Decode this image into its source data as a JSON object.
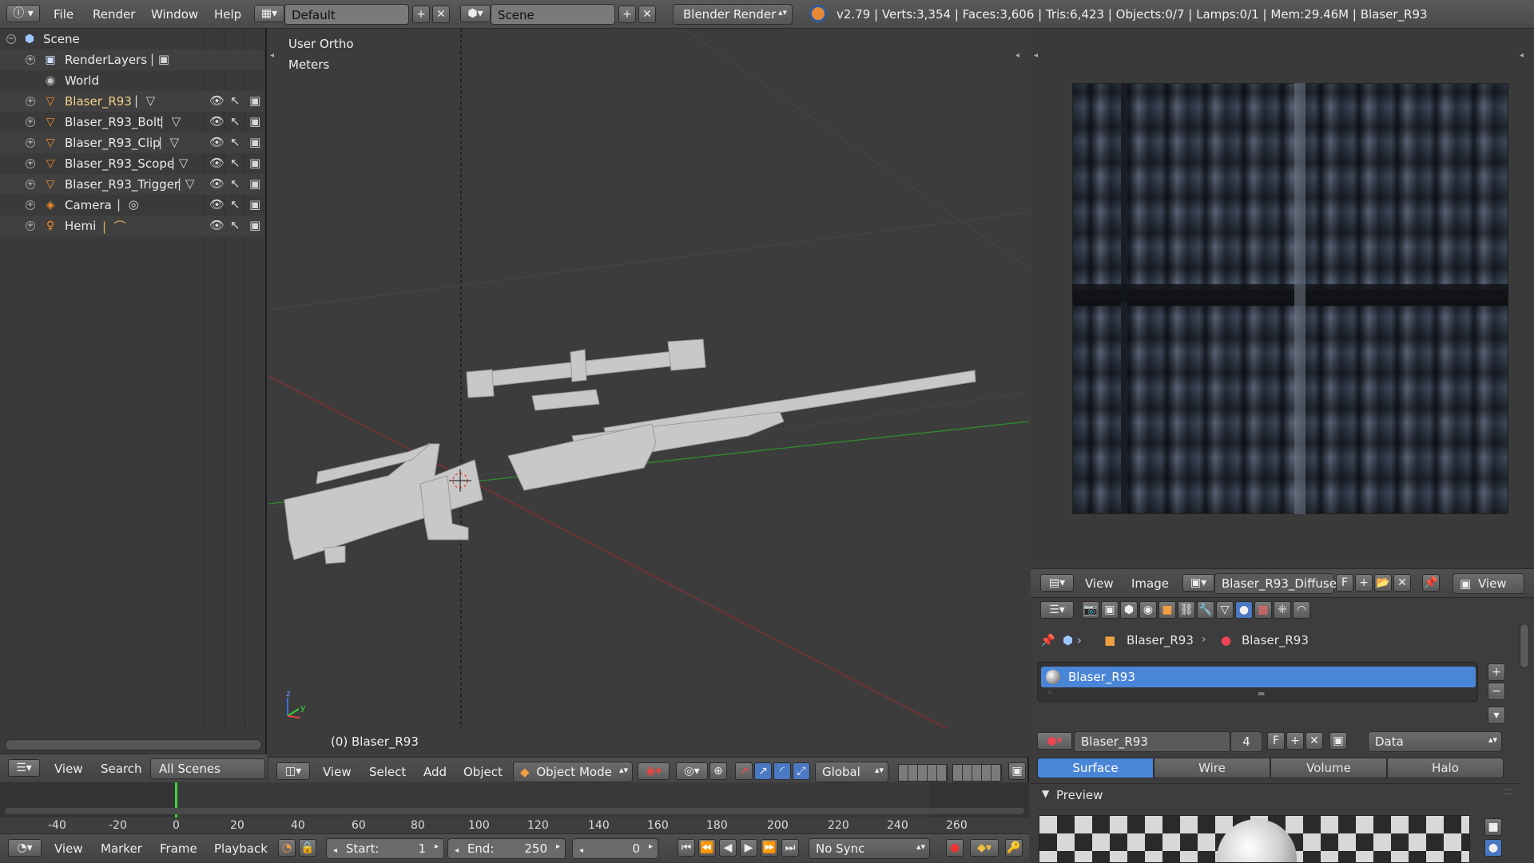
{
  "topbar": {
    "menus": [
      "File",
      "Render",
      "Window",
      "Help"
    ],
    "layout": "Default",
    "scene": "Scene",
    "engine": "Blender Render",
    "stats": "v2.79 | Verts:3,354 | Faces:3,606 | Tris:6,423 | Objects:0/7 | Lamps:0/1 | Mem:29.46M | Blaser_R93"
  },
  "outliner": {
    "items": [
      {
        "label": "Scene"
      },
      {
        "label": "RenderLayers"
      },
      {
        "label": "World"
      },
      {
        "label": "Blaser_R93"
      },
      {
        "label": "Blaser_R93_Bolt"
      },
      {
        "label": "Blaser_R93_Clip"
      },
      {
        "label": "Blaser_R93_Scope"
      },
      {
        "label": "Blaser_R93_Trigger"
      },
      {
        "label": "Camera"
      },
      {
        "label": "Hemi"
      }
    ],
    "footer": {
      "view": "View",
      "search": "Search",
      "filter": "All Scenes"
    }
  },
  "viewport": {
    "view_name": "User Ortho",
    "units": "Meters",
    "object_label": "(0) Blaser_R93",
    "header": {
      "view": "View",
      "select": "Select",
      "add": "Add",
      "object": "Object",
      "mode": "Object Mode",
      "orientation": "Global"
    }
  },
  "image_editor": {
    "header": {
      "view": "View",
      "image": "Image",
      "image_name": "Blaser_R93_Diffuse...",
      "fake": "F",
      "view2": "View"
    }
  },
  "properties": {
    "breadcrumb": [
      "Blaser_R93",
      "Blaser_R93"
    ],
    "material_slot": "Blaser_R93",
    "material_name": "Blaser_R93",
    "users": "4",
    "fake": "F",
    "link": "Data",
    "tabs": [
      "Surface",
      "Wire",
      "Volume",
      "Halo"
    ],
    "preview_label": "Preview"
  },
  "timeline": {
    "ticks": [
      "-40",
      "-20",
      "0",
      "20",
      "40",
      "60",
      "80",
      "100",
      "120",
      "140",
      "160",
      "180",
      "200",
      "220",
      "240",
      "260"
    ],
    "current_frame_marker": 0,
    "menus": [
      "View",
      "Marker",
      "Frame",
      "Playback"
    ],
    "start_label": "Start:",
    "start": "1",
    "end_label": "End:",
    "end": "250",
    "current": "0",
    "sync": "No Sync"
  },
  "colors": {
    "accent_blue": "#4a90d9",
    "selected_row": "#5680c2",
    "timeline_green": "#3fd13f"
  }
}
